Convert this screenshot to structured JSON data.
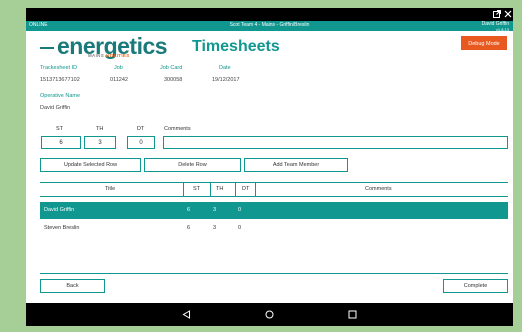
{
  "status_bar": {
    "left": "ONLINE",
    "center": "Scot Team 4 - Mains - Griffin/Breslin",
    "right_line1": "David Griffin",
    "right_line2": "v1.8.13"
  },
  "logo": {
    "main": "energetics",
    "sub_mains": "MAINS",
    "sub_utilities": "UTILITIES"
  },
  "page_title": "Timesheets",
  "debug_button": "Debug Mode",
  "info": {
    "trackid_label": "Trackesheet ID",
    "trackid_value": "1513713677102",
    "job_label": "Job",
    "job_value": "011242",
    "jobcard_label": "Job Card",
    "jobcard_value": "300058",
    "date_label": "Date",
    "date_value": "19/12/2017",
    "operative_label": "Operative Name",
    "operative_value": "David Griffin"
  },
  "entry": {
    "st_label": "ST",
    "th_label": "TH",
    "dt_label": "DT",
    "comments_label": "Comments",
    "st_value": "6",
    "th_value": "3",
    "dt_value": "0",
    "comments_value": ""
  },
  "buttons": {
    "update": "Update Selected Row",
    "delete": "Delete Row",
    "add_member": "Add Team Member",
    "back": "Back",
    "complete": "Complete"
  },
  "table": {
    "headers": [
      "Title",
      "ST",
      "TH",
      "DT",
      "Comments"
    ],
    "rows": [
      {
        "title": "David Griffin",
        "st": "6",
        "th": "3",
        "dt": "0",
        "comments": ""
      },
      {
        "title": "Steven Breslin",
        "st": "6",
        "th": "3",
        "dt": "0",
        "comments": ""
      }
    ]
  },
  "colors": {
    "accent": "#109790",
    "debug": "#e8591f",
    "background": "#a5cf96"
  },
  "icons": [
    "external-window-icon",
    "close-icon",
    "back-nav-icon",
    "home-nav-icon",
    "recents-nav-icon"
  ]
}
